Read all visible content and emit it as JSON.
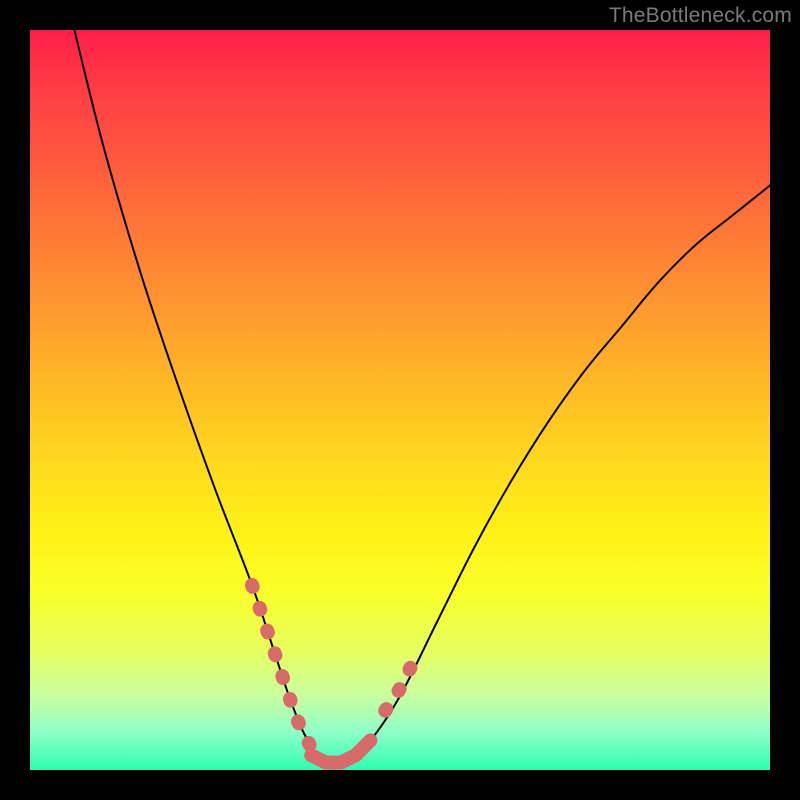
{
  "watermark": "TheBottleneck.com",
  "chart_data": {
    "type": "line",
    "title": "",
    "xlabel": "",
    "ylabel": "",
    "xlim": [
      0,
      100
    ],
    "ylim": [
      0,
      100
    ],
    "grid": false,
    "series": [
      {
        "name": "bottleneck-curve",
        "color": "#000000",
        "x": [
          6,
          10,
          15,
          20,
          25,
          30,
          33,
          35,
          37,
          39,
          41,
          43,
          46,
          50,
          55,
          60,
          65,
          70,
          75,
          80,
          85,
          90,
          95,
          100
        ],
        "values": [
          100,
          84,
          67,
          52,
          38,
          25,
          16,
          10,
          5,
          2,
          1,
          1.5,
          4,
          10,
          20,
          30,
          39,
          47,
          54,
          60,
          66,
          71,
          75,
          79
        ]
      },
      {
        "name": "highlight-segment-left",
        "color": "#d86a6a",
        "x": [
          30,
          32,
          34,
          36,
          38
        ],
        "values": [
          25,
          19,
          13,
          7,
          3
        ]
      },
      {
        "name": "highlight-segment-bottom",
        "color": "#d86a6a",
        "x": [
          38,
          40,
          42,
          44,
          46
        ],
        "values": [
          2,
          1,
          1,
          2,
          4
        ]
      },
      {
        "name": "highlight-segment-right",
        "color": "#d86a6a",
        "x": [
          48,
          50,
          52
        ],
        "values": [
          8,
          11,
          15
        ]
      }
    ],
    "background_gradient": {
      "top": "#ff1e4a",
      "mid": "#ffe81a",
      "bottom": "#2cffb0"
    }
  }
}
